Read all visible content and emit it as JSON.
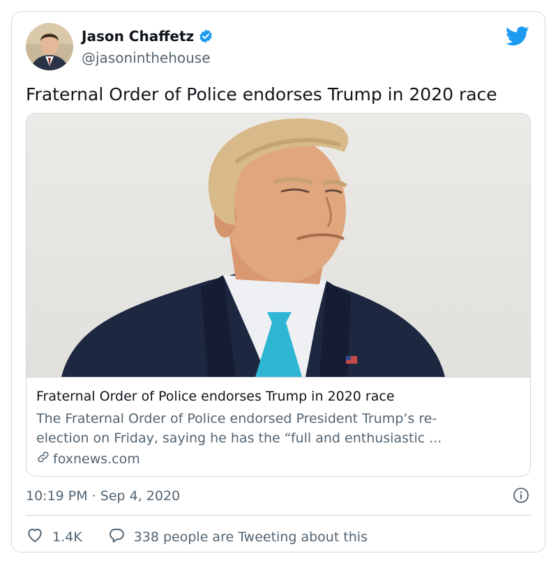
{
  "author": {
    "name": "Jason Chaffetz",
    "handle": "@jasoninthehouse",
    "verified": true
  },
  "tweet": {
    "text": "Fraternal Order of Police endorses Trump in 2020 race",
    "timestamp": "10:19 PM · Sep 4, 2020"
  },
  "card": {
    "title": "Fraternal Order of Police endorses Trump in 2020 race",
    "description_line1": "The Fraternal Order of Police endorsed President Trump’s re-",
    "description_line2": "election on Friday, saying he has the “full and enthusiastic ...",
    "domain": "foxnews.com"
  },
  "actions": {
    "likes": "1.4K",
    "reply_text": "338 people are Tweeting about this"
  },
  "colors": {
    "brand": "#1d9bf0",
    "secondary_text": "#536471",
    "border": "#cfd9de"
  },
  "icons": [
    "twitter-bird-icon",
    "verified-badge-icon",
    "link-icon",
    "info-icon",
    "heart-icon",
    "reply-bubble-icon"
  ]
}
